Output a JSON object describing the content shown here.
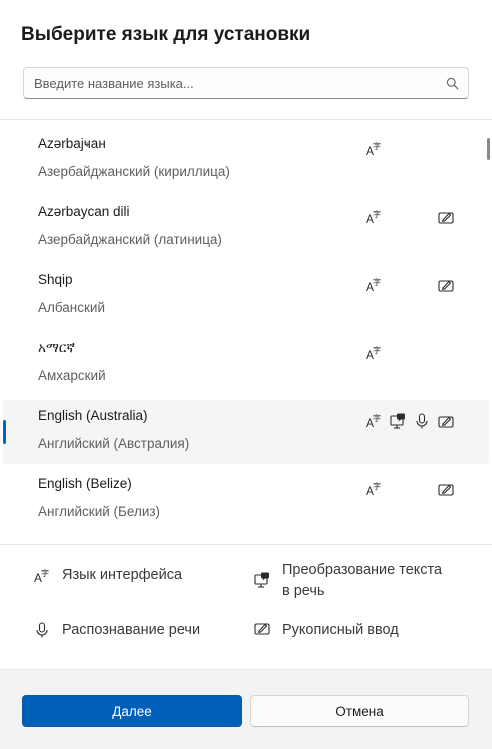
{
  "dialog": {
    "title": "Выберите язык для установки",
    "search_placeholder": "Введите название языка..."
  },
  "languages": [
    {
      "name": "Azərbaјҹан",
      "native": "Азербайджанский (кириллица)",
      "features": [
        "display-language-icon"
      ]
    },
    {
      "name": "Azərbaycan dili",
      "native": "Азербайджанский (латиница)",
      "features": [
        "display-language-icon",
        "handwriting-icon"
      ]
    },
    {
      "name": "Shqip",
      "native": "Албанский",
      "features": [
        "display-language-icon",
        "handwriting-icon"
      ]
    },
    {
      "name": "አማርኛ",
      "native": "Амхарский",
      "features": [
        "display-language-icon"
      ]
    },
    {
      "name": "English (Australia)",
      "native": "Английский (Австралия)",
      "features": [
        "display-language-icon",
        "text-to-speech-icon",
        "microphone-icon",
        "handwriting-icon"
      ],
      "selected": true
    },
    {
      "name": "English (Belize)",
      "native": "Английский (Белиз)",
      "features": [
        "display-language-icon",
        "handwriting-icon"
      ]
    }
  ],
  "legend": {
    "display_language": "Язык интерфейса",
    "text_to_speech_line1": "Преобразование текста",
    "text_to_speech_line2": "в речь",
    "speech_recognition": "Распознавание речи",
    "handwriting": "Рукописный ввод"
  },
  "buttons": {
    "next": "Далее",
    "cancel": "Отмена"
  },
  "colors": {
    "accent": "#005fb8",
    "selection_indicator": "#0067c0"
  }
}
